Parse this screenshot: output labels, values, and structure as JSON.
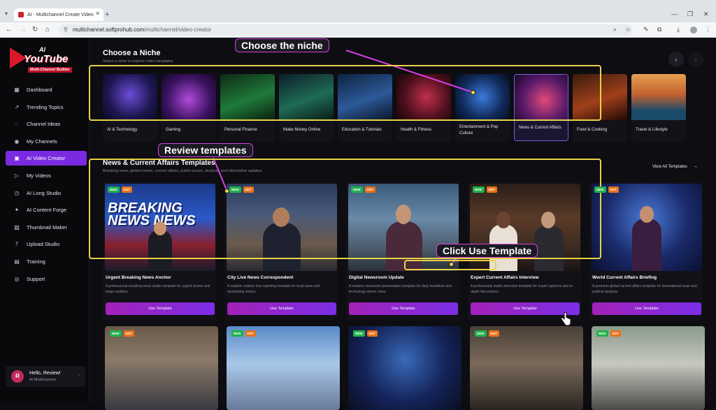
{
  "browser": {
    "tab_title": "AI - Multichannel Create Video",
    "url_host": "multichannel.softprohub.com",
    "url_path": "/multichannel/video-creator"
  },
  "sidebar": {
    "logo_ai": "AI",
    "logo_title": "YouTube",
    "logo_sub": "Multi-Channel Builder",
    "items": [
      {
        "label": "Dashboard",
        "icon": "grid-icon"
      },
      {
        "label": "Trending Topics",
        "icon": "trend-icon"
      },
      {
        "label": "Channel Ideas",
        "icon": "lightbulb-icon"
      },
      {
        "label": "My Channels",
        "icon": "channels-icon"
      },
      {
        "label": "AI Video Creator",
        "icon": "video-icon"
      },
      {
        "label": "My Videos",
        "icon": "play-icon"
      },
      {
        "label": "AI Long Studio",
        "icon": "clock-icon"
      },
      {
        "label": "AI Content Forge",
        "icon": "forge-icon"
      },
      {
        "label": "Thumbnail Maker",
        "icon": "image-icon"
      },
      {
        "label": "Upload Studio",
        "icon": "upload-icon"
      },
      {
        "label": "Training",
        "icon": "training-icon"
      },
      {
        "label": "Support",
        "icon": "support-icon"
      }
    ],
    "active_index": 4,
    "user": {
      "initial": "R",
      "name": "Hello, Review!",
      "plan": "AI Multichannel"
    }
  },
  "niche": {
    "heading": "Choose a Niche",
    "subheading": "Select a niche to explore video templates",
    "items": [
      {
        "label": "AI & Technology"
      },
      {
        "label": "Gaming"
      },
      {
        "label": "Personal Finance"
      },
      {
        "label": "Make Money Online"
      },
      {
        "label": "Education & Tutorials"
      },
      {
        "label": "Health & Fitness"
      },
      {
        "label": "Entertainment & Pop Culture"
      },
      {
        "label": "News & Current Affairs"
      },
      {
        "label": "Food & Cooking"
      },
      {
        "label": "Travel & Lifestyle"
      }
    ],
    "selected_index": 7
  },
  "templates": {
    "heading": "News & Current Affairs Templates",
    "subheading": "Breaking news, global events, current affairs, public issues, analysis, and informative updates.",
    "view_all": "View All Templates",
    "badge_new": "NEW",
    "badge_hot": "HOT",
    "use_label": "Use Template",
    "cards": [
      {
        "title": "Urgent Breaking News Anchor",
        "desc": "A professional breaking-news studio template for urgent stories and major updates.",
        "thumb_text": "BREAKING NEWS NEWS"
      },
      {
        "title": "City Live News Correspondent",
        "desc": "A realistic outdoor live-reporting template for local news and developing stories."
      },
      {
        "title": "Digital Newsroom Update",
        "desc": "A modern newsroom presentation template for daily headlines and technology-driven news."
      },
      {
        "title": "Expert Current Affairs Interview",
        "desc": "A professional studio interview template for expert opinions and in-depth discussions."
      },
      {
        "title": "World Current Affairs Briefing",
        "desc": "A premium global current affairs template for international news and political analysis."
      }
    ]
  },
  "annotations": {
    "choose_niche": "Choose the niche",
    "review_templates": "Review templates",
    "click_use": "Click Use Template"
  },
  "colors": {
    "accent": "#7a2ae0",
    "callout_border": "#d540e0",
    "highlight_box": "#e8d24a"
  }
}
